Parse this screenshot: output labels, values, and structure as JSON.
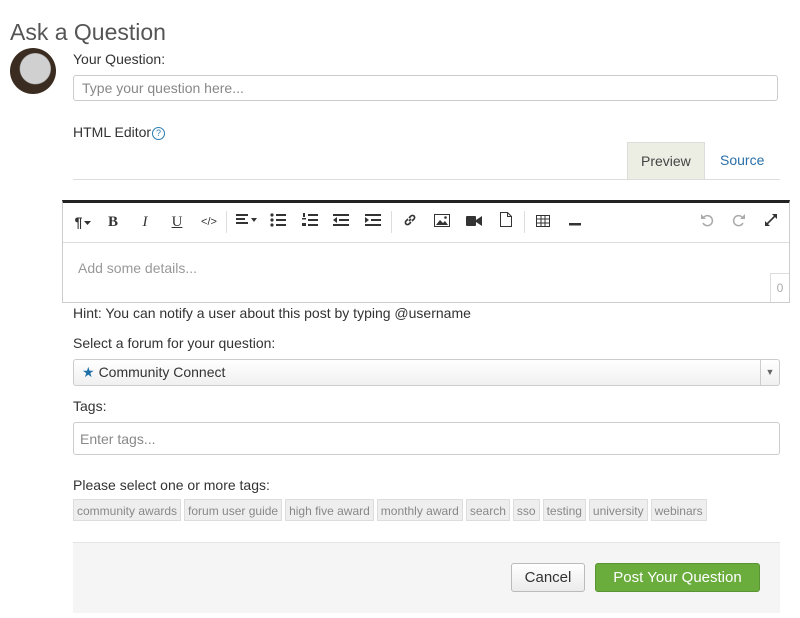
{
  "page": {
    "title": "Ask a Question"
  },
  "question": {
    "label": "Your Question:",
    "placeholder": "Type your question here..."
  },
  "editor": {
    "label": "HTML Editor",
    "help_icon": "?",
    "tabs": [
      "Preview",
      "Source"
    ],
    "active_tab": "Preview",
    "toolbar": {
      "paragraph": "¶",
      "bold": "B",
      "italic": "I",
      "underline": "U",
      "code": "</>",
      "icons": [
        "paragraph-icon",
        "bold-icon",
        "italic-icon",
        "underline-icon",
        "code-icon",
        "align-icon",
        "bullet-list-icon",
        "numbered-list-icon",
        "outdent-icon",
        "indent-icon",
        "link-icon",
        "image-icon",
        "video-icon",
        "file-icon",
        "table-icon",
        "horizontal-rule-icon",
        "undo-icon",
        "redo-icon",
        "fullscreen-icon"
      ]
    },
    "placeholder": "Add some details...",
    "char_count": "0"
  },
  "hint": "Hint: You can notify a user about this post by typing @username",
  "forum": {
    "label": "Select a forum for your question:",
    "selected": "Community Connect",
    "icon": "star-icon"
  },
  "tags": {
    "label": "Tags:",
    "placeholder": "Enter tags...",
    "select_label": "Please select one or more tags:",
    "options": [
      "community awards",
      "forum user guide",
      "high five award",
      "monthly award",
      "search",
      "sso",
      "testing",
      "university",
      "webinars"
    ]
  },
  "actions": {
    "cancel": "Cancel",
    "post": "Post Your Question"
  },
  "colors": {
    "accent": "#6aad3d",
    "link": "#2a6fa8",
    "star": "#1d6fa5"
  }
}
